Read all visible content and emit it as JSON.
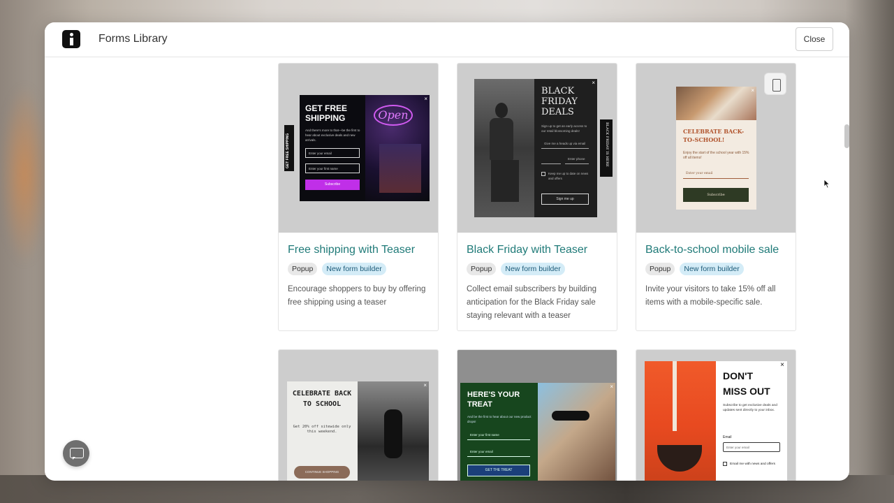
{
  "header": {
    "title": "Forms Library",
    "close_label": "Close"
  },
  "cards": [
    {
      "title": "Free shipping with Teaser",
      "tags": [
        "Popup",
        "New form builder"
      ],
      "description": "Encourage shoppers to buy by offering free shipping using a teaser",
      "preview": {
        "teaser": "GET FREE SHIPPING",
        "headline": "GET FREE SHIPPING",
        "subtext": "And there's more to that—be the first to hear about exclusive deals and new arrivals.",
        "email_placeholder": "Enter your email",
        "name_placeholder": "Enter your first name",
        "button": "Subscribe",
        "neon": "Open"
      }
    },
    {
      "title": "Black Friday with Teaser",
      "tags": [
        "Popup",
        "New form builder"
      ],
      "description": "Collect email subscribers by building anticipation for the Black Friday sale staying relevant with a teaser",
      "preview": {
        "teaser": "BLACK FRIDAY IS HERE",
        "headline": "BLACK FRIDAY DEALS",
        "subtext": "Sign up to get an early access to our retail blossoming deals!",
        "email_placeholder": "Give me a heads up via email",
        "phone_placeholder": "Enter phone",
        "checkbox": "Keep me up to date on news and offers",
        "button": "Sign me up"
      }
    },
    {
      "title": "Back-to-school mobile sale",
      "tags": [
        "Popup",
        "New form builder"
      ],
      "description": "Invite your visitors to take 15% off all items with a mobile-specific sale.",
      "preview": {
        "headline": "CELEBRATE BACK-TO-SCHOOL!",
        "subtext": "Enjoy the start of the school year with 15% off all items!",
        "email_placeholder": "Enter your email",
        "button": "Subscribe"
      }
    },
    {
      "preview": {
        "headline": "CELEBRATE BACK TO SCHOOL",
        "subtext": "Get 20% off sitewide only this weekend.",
        "button": "CONTINUE SHOPPING"
      }
    },
    {
      "preview": {
        "headline": "HERE'S YOUR TREAT",
        "subtext": "And be the first to hear about our new product drops!",
        "name_placeholder": "Enter your first name",
        "email_placeholder": "Enter your email",
        "button": "GET THE TREAT"
      }
    },
    {
      "preview": {
        "headline": "DON'T MISS OUT",
        "subtext": "Subscribe to get exclusive deals and updates sent directly to your inbox.",
        "email_label": "Email",
        "email_placeholder": "Enter your email",
        "checkbox": "Email me with news and offers"
      }
    }
  ],
  "colors": {
    "title_teal": "#1f7a78",
    "tag_blue_bg": "#d4ecf7",
    "subscribe_purple": "#c02fe8"
  }
}
